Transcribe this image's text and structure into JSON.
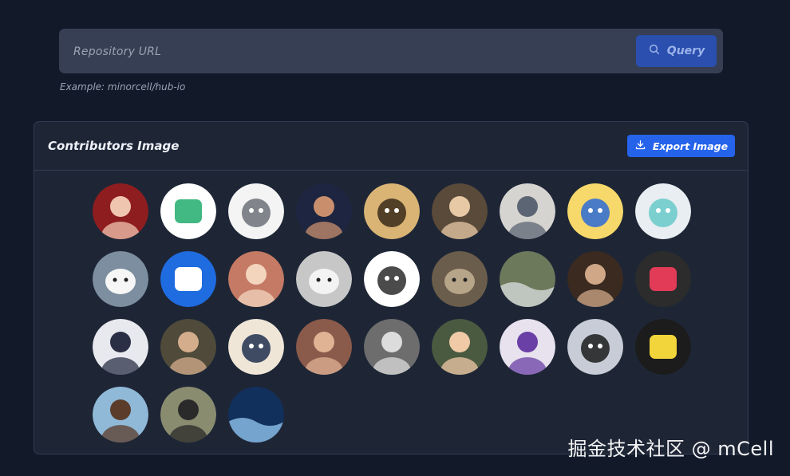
{
  "search": {
    "placeholder": "Repository URL",
    "value": "",
    "query_label": "Query",
    "example": "Example: minorcell/hub-io"
  },
  "contributors_card": {
    "title": "Contributors Image",
    "export_label": "Export Image"
  },
  "avatars": [
    {
      "name": "avatar-person-red-glasses",
      "bg": "#8e1d1f",
      "fg": "#f0c5b0",
      "kind": "person"
    },
    {
      "name": "avatar-vue-bot",
      "bg": "#ffffff",
      "fg": "#42b883",
      "kind": "logo"
    },
    {
      "name": "avatar-totoro",
      "bg": "#f4f4f4",
      "fg": "#6d7079",
      "kind": "character"
    },
    {
      "name": "avatar-person-curly-hair",
      "bg": "#1d2540",
      "fg": "#c98f6d",
      "kind": "person"
    },
    {
      "name": "avatar-one-piece-luffy",
      "bg": "#d9b475",
      "fg": "#3a2a1a",
      "kind": "character"
    },
    {
      "name": "avatar-person-dark-shirt",
      "bg": "#5a4a3a",
      "fg": "#e8c9a6",
      "kind": "person"
    },
    {
      "name": "avatar-person-desk",
      "bg": "#d6d4d0",
      "fg": "#5b6573",
      "kind": "person"
    },
    {
      "name": "avatar-yellow-cat",
      "bg": "#f7d86a",
      "fg": "#2c6bd6",
      "kind": "character"
    },
    {
      "name": "avatar-anime-miku",
      "bg": "#e9eef2",
      "fg": "#69c9c9",
      "kind": "character"
    },
    {
      "name": "avatar-panda",
      "bg": "#7c8ea0",
      "fg": "#f6f6f6",
      "kind": "animal"
    },
    {
      "name": "avatar-blue-robot",
      "bg": "#1f6ce0",
      "fg": "#ffffff",
      "kind": "logo"
    },
    {
      "name": "avatar-person-glasses-photo",
      "bg": "#c47a64",
      "fg": "#f3d5bd",
      "kind": "person"
    },
    {
      "name": "avatar-white-cat",
      "bg": "#c7c7c7",
      "fg": "#f3f3f3",
      "kind": "animal"
    },
    {
      "name": "avatar-anime-sketch",
      "bg": "#ffffff",
      "fg": "#2b2b2b",
      "kind": "character"
    },
    {
      "name": "avatar-tabby-cat",
      "bg": "#6b5d4b",
      "fg": "#b7a58a",
      "kind": "animal"
    },
    {
      "name": "avatar-sailboat",
      "bg": "#6c7a5b",
      "fg": "#e2e6ea",
      "kind": "scene"
    },
    {
      "name": "avatar-curly-hair-woman",
      "bg": "#3a2a20",
      "fg": "#d0a887",
      "kind": "person"
    },
    {
      "name": "avatar-colorful-pixel-logo",
      "bg": "#2c2c2c",
      "fg": "#e13b57",
      "kind": "logo"
    },
    {
      "name": "avatar-person-with-cat",
      "bg": "#e8e9ee",
      "fg": "#2a2f45",
      "kind": "person"
    },
    {
      "name": "avatar-person-beard",
      "bg": "#4f4a3a",
      "fg": "#d4ad8c",
      "kind": "person"
    },
    {
      "name": "avatar-opera-mask",
      "bg": "#efe6d8",
      "fg": "#1f2f4f",
      "kind": "character"
    },
    {
      "name": "avatar-person-thinking",
      "bg": "#8a5a4a",
      "fg": "#e0b394",
      "kind": "person"
    },
    {
      "name": "avatar-person-bw",
      "bg": "#6d6d6d",
      "fg": "#dcdcdc",
      "kind": "person"
    },
    {
      "name": "avatar-person-blond",
      "bg": "#4a5a40",
      "fg": "#f0caa7",
      "kind": "person"
    },
    {
      "name": "avatar-purple-jersey",
      "bg": "#e7e2ee",
      "fg": "#6a3fa6",
      "kind": "person"
    },
    {
      "name": "avatar-anime-girl-dark",
      "bg": "#c8ccd6",
      "fg": "#1b1b1b",
      "kind": "character"
    },
    {
      "name": "avatar-yellow-logo",
      "bg": "#1c1c1c",
      "fg": "#f2d53a",
      "kind": "logo"
    },
    {
      "name": "avatar-person-beach",
      "bg": "#90b9d8",
      "fg": "#5b3c2a",
      "kind": "person"
    },
    {
      "name": "avatar-person-camera",
      "bg": "#8a8c70",
      "fg": "#2a2a2a",
      "kind": "person"
    },
    {
      "name": "avatar-blue-space",
      "bg": "#12305c",
      "fg": "#9fd6ff",
      "kind": "scene"
    }
  ],
  "watermark": "掘金技术社区 @ mCell"
}
